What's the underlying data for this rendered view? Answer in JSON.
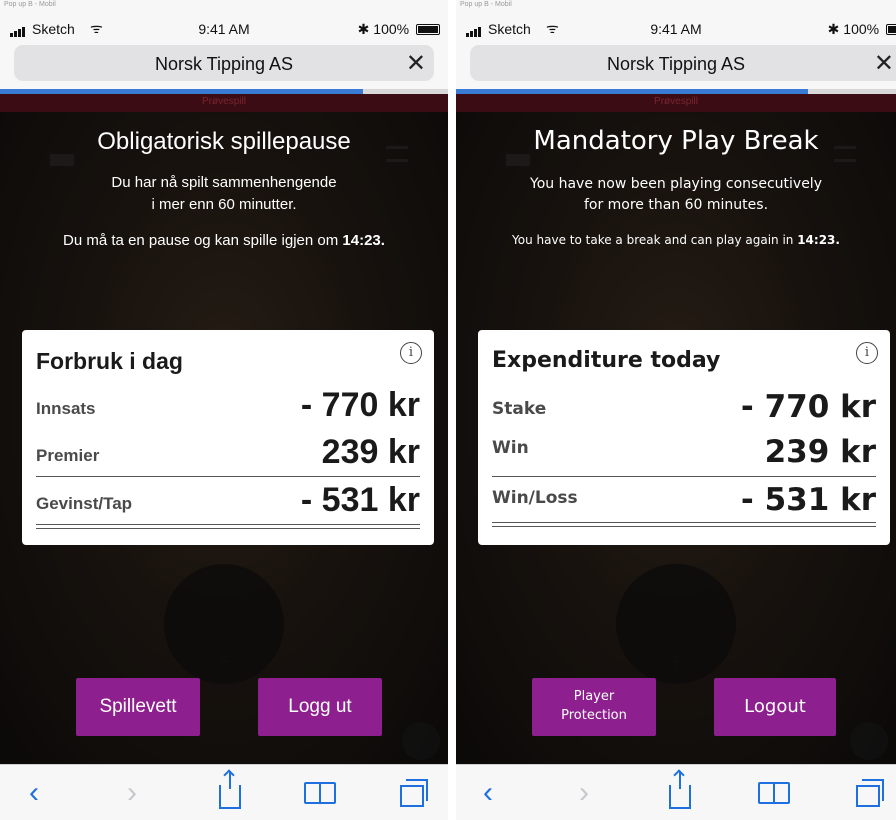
{
  "left": {
    "caption": "Pop up B - Mobil",
    "status": {
      "carrier": "Sketch",
      "wifi": "ᯤ",
      "time": "9:41 AM",
      "bluetooth": "✱",
      "battery": "100%"
    },
    "browser": {
      "title": "Norsk Tipping AS",
      "close": "✕",
      "progress": 0.81
    },
    "game": {
      "trial_label": "Prøvespill"
    },
    "pause": {
      "title": "Obligatorisk spillepause",
      "line1": "Du har nå spilt sammenhengende",
      "line2": "i mer enn 60 minutter.",
      "line3_prefix": "Du må ta en pause og kan spille igjen om ",
      "line3_time": "14:23."
    },
    "card": {
      "title": "Forbruk i dag",
      "info": "i",
      "rows": [
        {
          "label": "Innsats",
          "value": "- 770 kr"
        },
        {
          "label": "Premier",
          "value": "239 kr"
        },
        {
          "label": "Gevinst/Tap",
          "value": "- 531 kr"
        }
      ]
    },
    "buttons": {
      "left": "Spillevett",
      "right": "Logg ut"
    },
    "toolbar": {
      "back": "‹",
      "forward": "›"
    }
  },
  "right": {
    "caption": "Pop up B - Mobil",
    "status": {
      "carrier": "Sketch",
      "wifi": "ᯤ",
      "time": "9:41 AM",
      "bluetooth": "✱",
      "battery": "100%"
    },
    "browser": {
      "title": "Norsk Tipping AS",
      "close": "✕",
      "progress": 0.8
    },
    "game": {
      "trial_label": "Prøvespill"
    },
    "pause": {
      "title": "Mandatory Play Break",
      "line1": "You have now been playing consecutively",
      "line2": "for more than 60 minutes.",
      "line3_prefix": "You have to take a break and can play again in ",
      "line3_time": "14:23."
    },
    "card": {
      "title": "Expenditure today",
      "info": "i",
      "rows": [
        {
          "label": "Stake",
          "value": "- 770 kr"
        },
        {
          "label": "Win",
          "value": "239 kr"
        },
        {
          "label": "Win/Loss",
          "value": "- 531 kr"
        }
      ]
    },
    "buttons": {
      "left_line1": "Player",
      "left_line2": "Protection",
      "right": "Logout"
    },
    "toolbar": {
      "back": "‹",
      "forward": "›"
    }
  },
  "colors": {
    "accent_purple": "#8e1f8e",
    "ios_blue": "#1e6fe0",
    "progress_blue": "#3a7bd5"
  }
}
